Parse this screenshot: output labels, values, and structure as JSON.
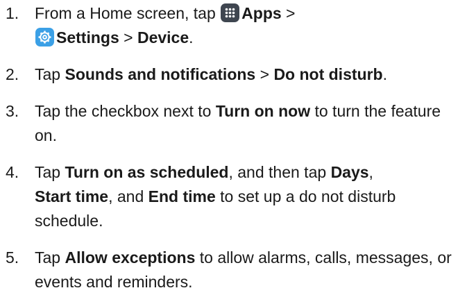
{
  "steps": [
    {
      "number": "1.",
      "parts": {
        "t1": "From a Home screen, tap ",
        "apps_icon": "apps-icon",
        "b1": "Apps",
        "t2": " >",
        "settings_icon": "settings-icon",
        "b2": "Settings",
        "t3": " > ",
        "b3": "Device",
        "t4": "."
      }
    },
    {
      "number": "2.",
      "parts": {
        "t1": "Tap ",
        "b1": "Sounds and notifications",
        "t2": " > ",
        "b2": "Do not disturb",
        "t3": "."
      }
    },
    {
      "number": "3.",
      "parts": {
        "t1": "Tap the checkbox next to ",
        "b1": "Turn on now",
        "t2": " to turn the feature on."
      }
    },
    {
      "number": "4.",
      "parts": {
        "t1": "Tap ",
        "b1": "Turn on as scheduled",
        "t2": ", and then tap ",
        "b2": "Days",
        "t3": ",",
        "b3": "Start time",
        "t4": ", and ",
        "b4": "End time",
        "t5": " to set up a do not disturb schedule."
      }
    },
    {
      "number": "5.",
      "parts": {
        "t1": "Tap ",
        "b1": "Allow exceptions",
        "t2": " to allow alarms, calls, messages, or events and reminders."
      }
    }
  ],
  "colors": {
    "apps_icon_bg": "#3f4650",
    "settings_icon_bg": "#3ba0e6",
    "text": "#1a1a1a"
  }
}
